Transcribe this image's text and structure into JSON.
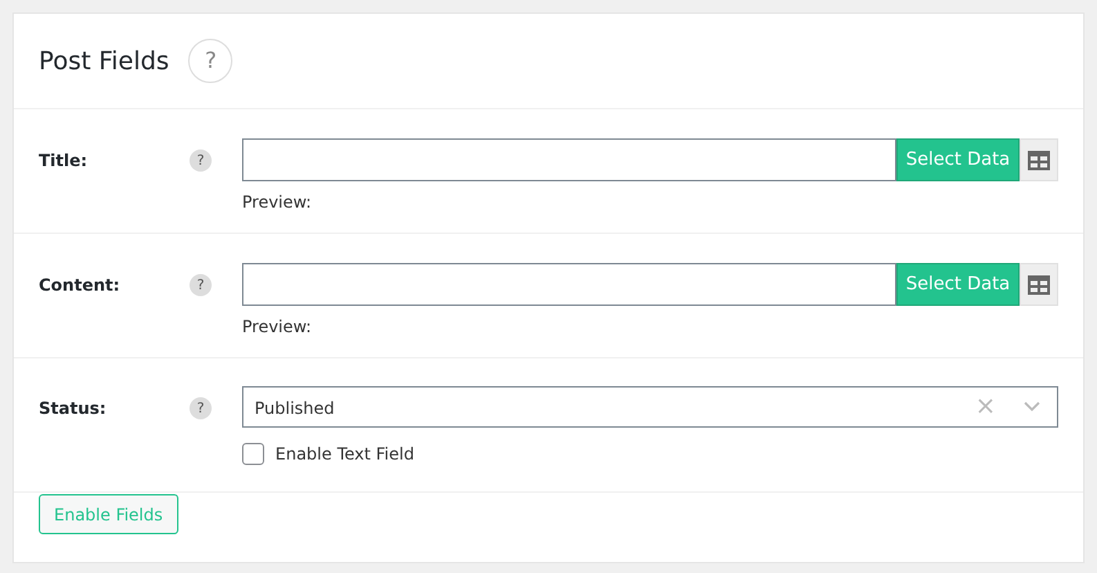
{
  "panel": {
    "title": "Post Fields",
    "help": "?"
  },
  "fields": [
    {
      "kind": "text",
      "label": "Title:",
      "help": "?",
      "button": "Select Data",
      "preview": "Preview:"
    },
    {
      "kind": "text",
      "label": "Content:",
      "help": "?",
      "button": "Select Data",
      "preview": "Preview:"
    },
    {
      "kind": "select",
      "label": "Status:",
      "help": "?",
      "value": "Published",
      "clear": "×",
      "checkbox": {
        "label": "Enable Text Field",
        "checked": false
      }
    }
  ],
  "footer": {
    "button": "Enable Fields"
  }
}
